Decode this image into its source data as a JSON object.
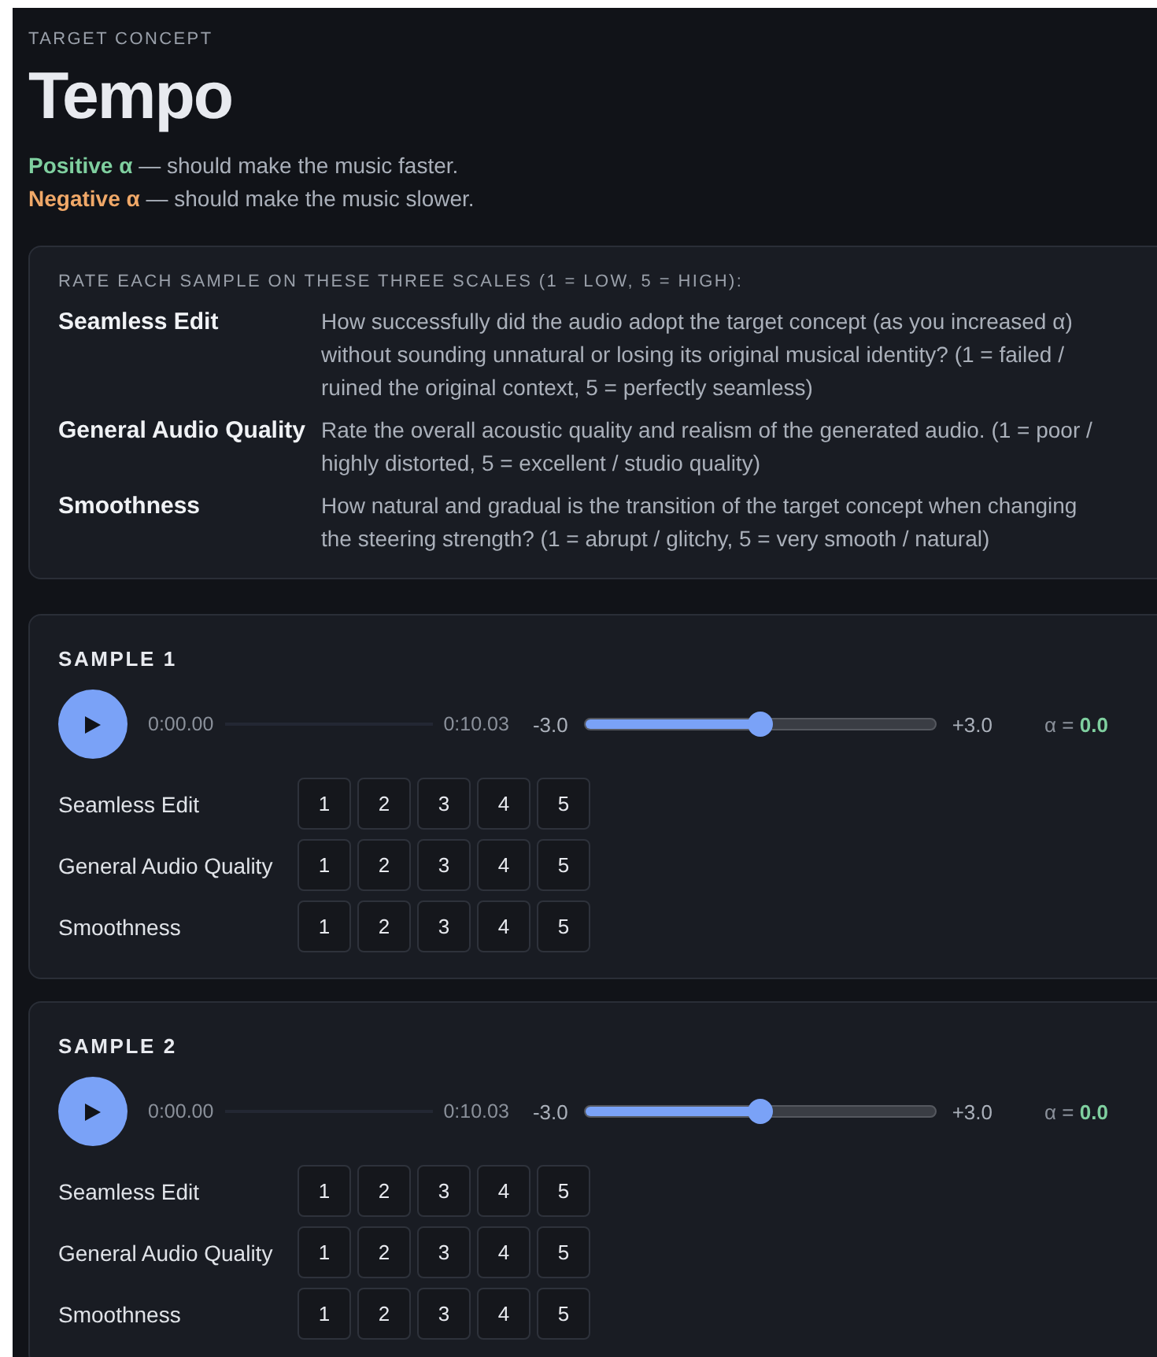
{
  "concept": {
    "label": "TARGET CONCEPT",
    "title": "Tempo",
    "lines": [
      {
        "kind": "positive",
        "lead": "Positive α",
        "text": "— should make the music faster."
      },
      {
        "kind": "negative",
        "lead": "Negative α",
        "text": "— should make the music slower."
      }
    ]
  },
  "scales": {
    "heading": "RATE EACH SAMPLE ON THESE THREE SCALES (1 = LOW, 5 = HIGH):",
    "items": [
      {
        "name": "Seamless Edit",
        "description": "How successfully did the audio adopt the target concept (as you increased α) without sounding unnatural or losing its original musical identity? (1 = failed / ruined the original context, 5 = perfectly seamless)"
      },
      {
        "name": "General Audio Quality",
        "description": "Rate the overall acoustic quality and realism of the generated audio. (1 = poor / highly distorted, 5 = excellent / studio quality)"
      },
      {
        "name": "Smoothness",
        "description": "How natural and gradual is the transition of the target concept when changing the steering strength? (1 = abrupt / glitchy, 5 = very smooth / natural)"
      }
    ]
  },
  "samples": [
    {
      "title": "SAMPLE 1",
      "time_current": "0:00.00",
      "time_total": "0:10.03",
      "progress": {
        "level": 0
      },
      "slider": {
        "min_label": "-3.0",
        "max_label": "+3.0",
        "level": 0.5
      },
      "alpha_label": "α =",
      "alpha_value": "0.0",
      "ratings": [
        {
          "name": "Seamless Edit",
          "options": [
            {
              "label": "1",
              "selected": false
            },
            {
              "label": "2",
              "selected": false
            },
            {
              "label": "3",
              "selected": false
            },
            {
              "label": "4",
              "selected": false
            },
            {
              "label": "5",
              "selected": false
            }
          ]
        },
        {
          "name": "General Audio Quality",
          "options": [
            {
              "label": "1",
              "selected": false
            },
            {
              "label": "2",
              "selected": false
            },
            {
              "label": "3",
              "selected": false
            },
            {
              "label": "4",
              "selected": false
            },
            {
              "label": "5",
              "selected": false
            }
          ]
        },
        {
          "name": "Smoothness",
          "options": [
            {
              "label": "1",
              "selected": false
            },
            {
              "label": "2",
              "selected": false
            },
            {
              "label": "3",
              "selected": false
            },
            {
              "label": "4",
              "selected": false
            },
            {
              "label": "5",
              "selected": false
            }
          ]
        }
      ]
    },
    {
      "title": "SAMPLE 2",
      "time_current": "0:00.00",
      "time_total": "0:10.03",
      "progress": {
        "level": 0
      },
      "slider": {
        "min_label": "-3.0",
        "max_label": "+3.0",
        "level": 0.5
      },
      "alpha_label": "α =",
      "alpha_value": "0.0",
      "ratings": [
        {
          "name": "Seamless Edit",
          "options": [
            {
              "label": "1",
              "selected": false
            },
            {
              "label": "2",
              "selected": false
            },
            {
              "label": "3",
              "selected": false
            },
            {
              "label": "4",
              "selected": false
            },
            {
              "label": "5",
              "selected": false
            }
          ]
        },
        {
          "name": "General Audio Quality",
          "options": [
            {
              "label": "1",
              "selected": false
            },
            {
              "label": "2",
              "selected": false
            },
            {
              "label": "3",
              "selected": false
            },
            {
              "label": "4",
              "selected": false
            },
            {
              "label": "5",
              "selected": false
            }
          ]
        },
        {
          "name": "Smoothness",
          "options": [
            {
              "label": "1",
              "selected": false
            },
            {
              "label": "2",
              "selected": false
            },
            {
              "label": "3",
              "selected": false
            },
            {
              "label": "4",
              "selected": false
            },
            {
              "label": "5",
              "selected": false
            }
          ]
        }
      ]
    }
  ]
}
